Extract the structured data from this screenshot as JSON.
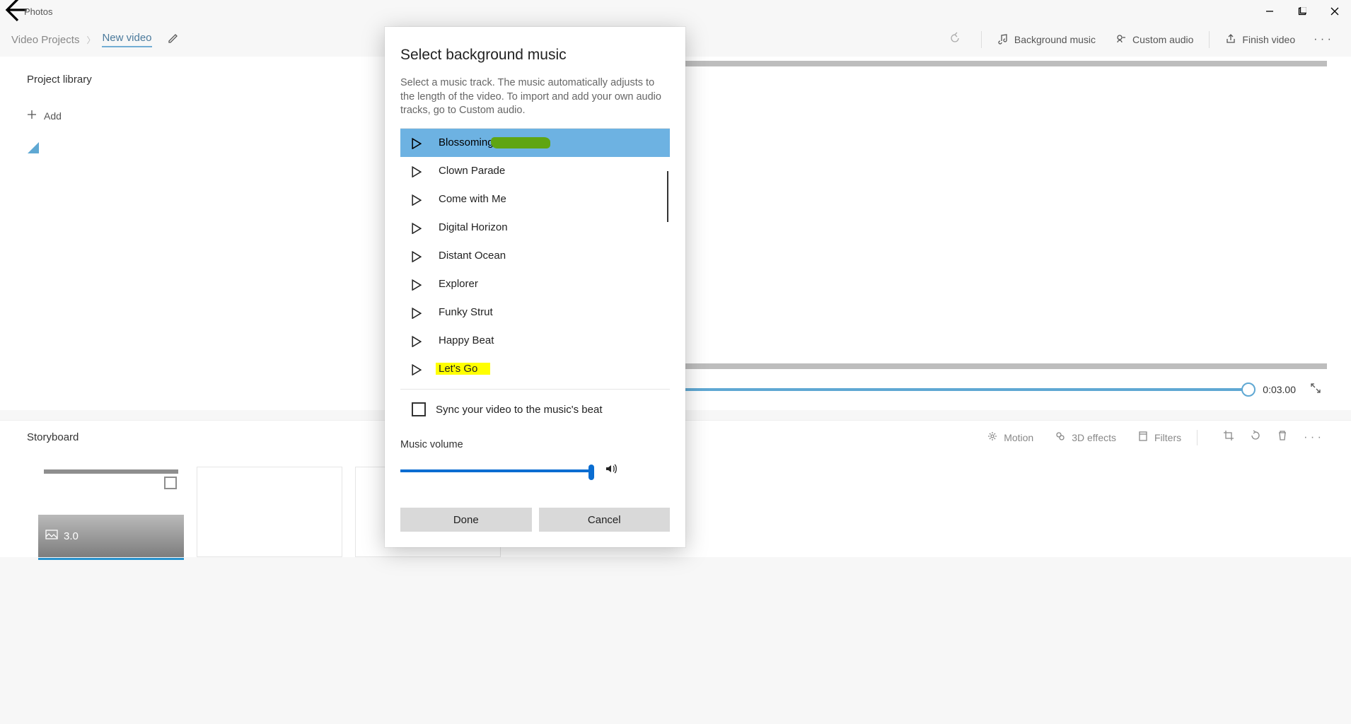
{
  "app": {
    "title": "Photos"
  },
  "breadcrumb": {
    "root": "Video Projects",
    "project": "New video"
  },
  "toolbar": {
    "bg_music": "Background music",
    "custom_audio": "Custom audio",
    "finish_video": "Finish video"
  },
  "library": {
    "title": "Project library",
    "add": "Add"
  },
  "timeline": {
    "time": "0:03.00"
  },
  "editbar": {
    "storyboard": "Storyboard",
    "motion": "Motion",
    "effects": "3D effects",
    "filters": "Filters"
  },
  "clip": {
    "duration": "3.0"
  },
  "dialog": {
    "title": "Select background music",
    "desc": "Select a music track. The music automatically adjusts to the length of the video. To import and add your own audio tracks, go to Custom audio.",
    "tracks": [
      "Blossoming",
      "Clown Parade",
      "Come with Me",
      "Digital Horizon",
      "Distant Ocean",
      "Explorer",
      "Funky Strut",
      "Happy Beat",
      "Let's Go"
    ],
    "sync": "Sync your video to the music's beat",
    "volume_label": "Music volume",
    "done": "Done",
    "cancel": "Cancel",
    "selected_index": 0,
    "highlighted_index": 8
  }
}
